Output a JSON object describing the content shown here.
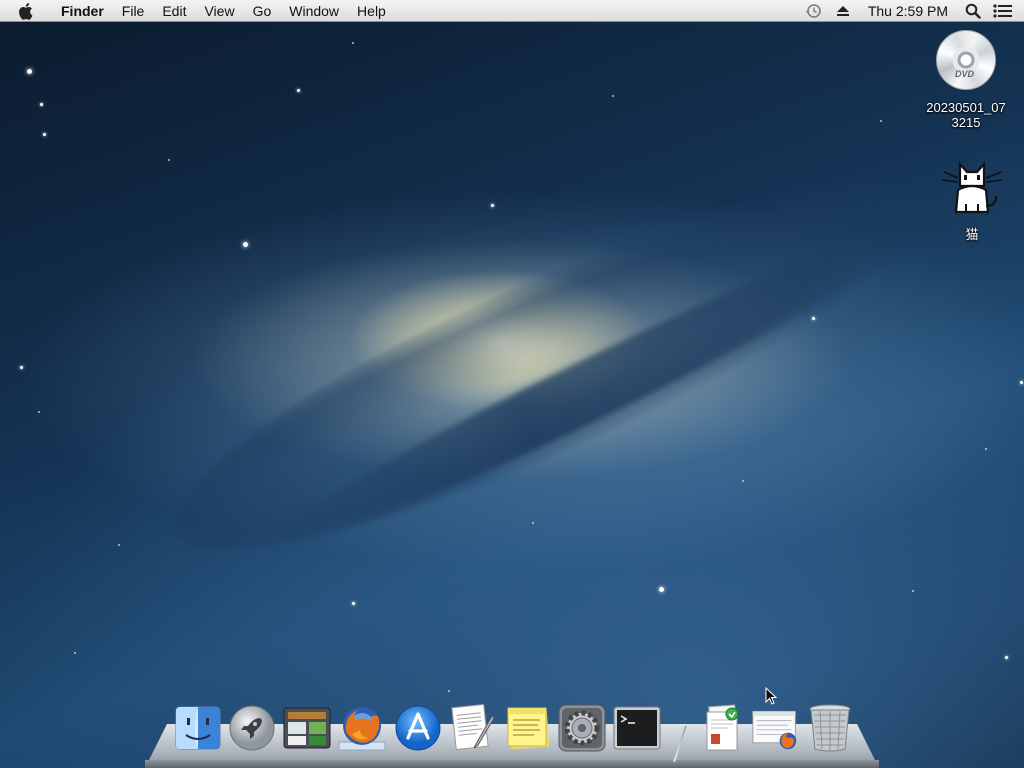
{
  "menubar": {
    "app_name": "Finder",
    "menus": [
      "File",
      "Edit",
      "View",
      "Go",
      "Window",
      "Help"
    ],
    "clock": "Thu 2:59 PM",
    "status_icons": [
      "time-machine-icon",
      "eject-icon",
      "spotlight-icon",
      "notification-center-icon"
    ]
  },
  "desktop": {
    "icons": [
      {
        "label_line1": "20230501_07",
        "label_line2": "3215",
        "icon": "dvd-disc-icon"
      },
      {
        "label_line1": "猫",
        "icon": "cat-icon"
      }
    ]
  },
  "dock": {
    "apps": [
      "finder-icon",
      "launchpad-icon",
      "photo-browser-icon",
      "firefox-icon",
      "app-store-icon",
      "textedit-icon",
      "stickies-icon",
      "system-preferences-icon",
      "terminal-icon"
    ],
    "stacks": [
      "documents-stack-icon",
      "downloads-stack-icon",
      "trash-icon"
    ]
  },
  "colors": {
    "menubar": "#e6e6e6",
    "wallpaper_dark": "#0d2236",
    "wallpaper_mid": "#1f4a72",
    "galaxy_core": "#fffad7"
  }
}
